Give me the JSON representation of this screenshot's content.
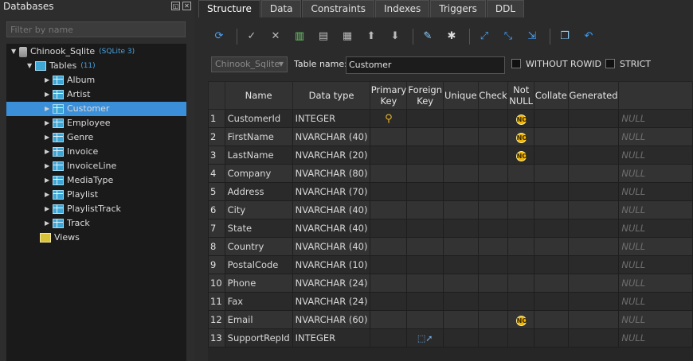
{
  "left_panel": {
    "title": "Databases",
    "filter_placeholder": "Filter by name",
    "tree": {
      "database": {
        "name": "Chinook_Sqlite",
        "tag": "(SQLite 3)"
      },
      "tables": {
        "label": "Tables",
        "count": "(11)",
        "items": [
          "Album",
          "Artist",
          "Customer",
          "Employee",
          "Genre",
          "Invoice",
          "InvoiceLine",
          "MediaType",
          "Playlist",
          "PlaylistTrack",
          "Track"
        ],
        "selected": "Customer"
      },
      "views": {
        "label": "Views"
      }
    }
  },
  "tabs": [
    "Structure",
    "Data",
    "Constraints",
    "Indexes",
    "Triggers",
    "DDL"
  ],
  "active_tab": "Structure",
  "toolbar_icons": [
    "refresh-icon",
    "commit-icon",
    "rollback-icon",
    "add-column-icon",
    "insert-column-icon",
    "delete-column-icon",
    "move-up-icon",
    "move-down-icon",
    "edit-icon",
    "settings-icon",
    "expand-icon",
    "collapse-icon",
    "import-icon",
    "copy-icon",
    "undo-icon"
  ],
  "table_header": {
    "db_select": "Chinook_Sqlite",
    "table_name_label": "Table name:",
    "table_name_value": "Customer",
    "without_rowid_label": "WITHOUT ROWID",
    "strict_label": "STRICT"
  },
  "columns_header": [
    "",
    "Name",
    "Data type",
    "Primary\nKey",
    "Foreign\nKey",
    "Unique",
    "Check",
    "Not\nNULL",
    "Collate",
    "Generated",
    ""
  ],
  "rows": [
    {
      "n": "1",
      "name": "CustomerId",
      "type": "INTEGER",
      "pk": true,
      "fk": false,
      "notnull": true,
      "default": "NULL"
    },
    {
      "n": "2",
      "name": "FirstName",
      "type": "NVARCHAR (40)",
      "pk": false,
      "fk": false,
      "notnull": true,
      "default": "NULL"
    },
    {
      "n": "3",
      "name": "LastName",
      "type": "NVARCHAR (20)",
      "pk": false,
      "fk": false,
      "notnull": true,
      "default": "NULL"
    },
    {
      "n": "4",
      "name": "Company",
      "type": "NVARCHAR (80)",
      "pk": false,
      "fk": false,
      "notnull": false,
      "default": "NULL"
    },
    {
      "n": "5",
      "name": "Address",
      "type": "NVARCHAR (70)",
      "pk": false,
      "fk": false,
      "notnull": false,
      "default": "NULL"
    },
    {
      "n": "6",
      "name": "City",
      "type": "NVARCHAR (40)",
      "pk": false,
      "fk": false,
      "notnull": false,
      "default": "NULL"
    },
    {
      "n": "7",
      "name": "State",
      "type": "NVARCHAR (40)",
      "pk": false,
      "fk": false,
      "notnull": false,
      "default": "NULL"
    },
    {
      "n": "8",
      "name": "Country",
      "type": "NVARCHAR (40)",
      "pk": false,
      "fk": false,
      "notnull": false,
      "default": "NULL"
    },
    {
      "n": "9",
      "name": "PostalCode",
      "type": "NVARCHAR (10)",
      "pk": false,
      "fk": false,
      "notnull": false,
      "default": "NULL"
    },
    {
      "n": "10",
      "name": "Phone",
      "type": "NVARCHAR (24)",
      "pk": false,
      "fk": false,
      "notnull": false,
      "default": "NULL"
    },
    {
      "n": "11",
      "name": "Fax",
      "type": "NVARCHAR (24)",
      "pk": false,
      "fk": false,
      "notnull": false,
      "default": "NULL"
    },
    {
      "n": "12",
      "name": "Email",
      "type": "NVARCHAR (60)",
      "pk": false,
      "fk": false,
      "notnull": true,
      "default": "NULL"
    },
    {
      "n": "13",
      "name": "SupportRepId",
      "type": "INTEGER",
      "pk": false,
      "fk": true,
      "notnull": false,
      "default": "NULL"
    }
  ],
  "icons": {
    "pk": "key-icon",
    "nn": "not-null-icon",
    "fk": "foreign-key-icon"
  }
}
